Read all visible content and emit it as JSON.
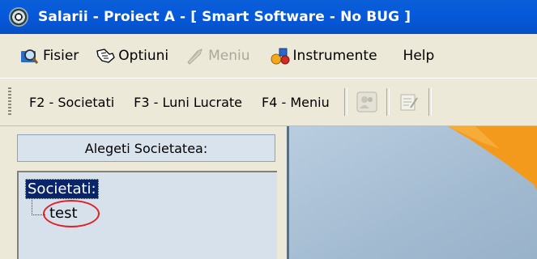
{
  "window": {
    "title": "Salarii - Proiect A  - [ Smart Software - No BUG ]"
  },
  "menubar": {
    "items": [
      {
        "label": "Fisier",
        "icon": "search-folder-icon",
        "enabled": true
      },
      {
        "label": "Optiuni",
        "icon": "hand-tool-icon",
        "enabled": true
      },
      {
        "label": "Meniu",
        "icon": "quill-icon",
        "enabled": false
      },
      {
        "label": "Instrumente",
        "icon": "tools-icon",
        "enabled": true
      },
      {
        "label": "Help",
        "icon": "",
        "enabled": true
      }
    ]
  },
  "toolbar": {
    "buttons": [
      {
        "label": "F2 - Societati"
      },
      {
        "label": "F3 - Luni Lucrate"
      },
      {
        "label": "F4 - Meniu"
      }
    ],
    "icons": [
      "people-icon",
      "edit-icon"
    ]
  },
  "leftpanel": {
    "header": "Alegeti Societatea:",
    "tree": {
      "root": "Societati:",
      "children": [
        "test"
      ]
    }
  }
}
